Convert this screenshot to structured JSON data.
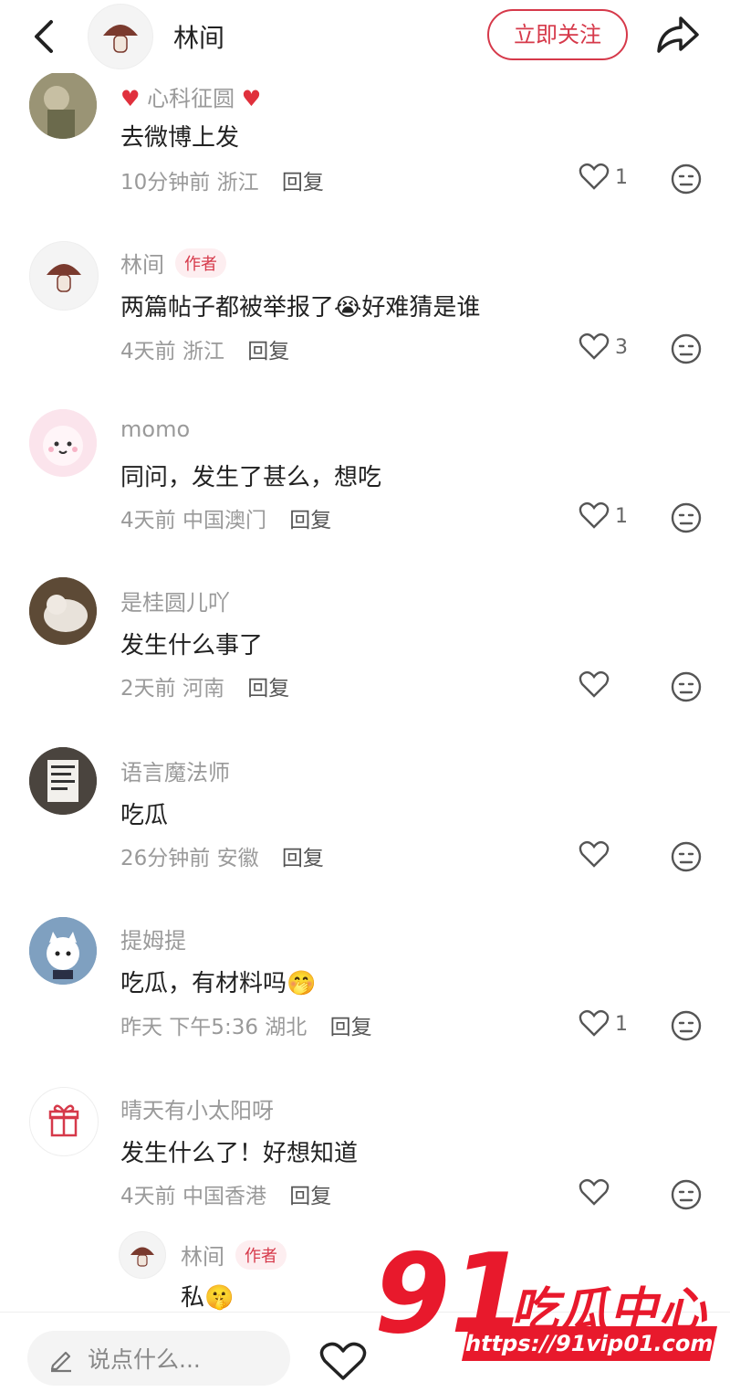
{
  "header": {
    "title": "林间",
    "follow_label": "立即关注"
  },
  "comments": [
    {
      "name": "心科征圆",
      "text": "去微博上发",
      "time": "10分钟前",
      "location": "浙江",
      "reply": "回复",
      "likes": "1",
      "author": ""
    },
    {
      "name": "林间",
      "text": "两篇帖子都被举报了😭好难猜是谁",
      "time": "4天前",
      "location": "浙江",
      "reply": "回复",
      "likes": "3",
      "author": "作者"
    },
    {
      "name": "momo",
      "text": "同问，发生了甚么，想吃",
      "time": "4天前",
      "location": "中国澳门",
      "reply": "回复",
      "likes": "1",
      "author": ""
    },
    {
      "name": "是桂圆儿吖",
      "text": "发生什么事了",
      "time": "2天前",
      "location": "河南",
      "reply": "回复",
      "likes": "",
      "author": ""
    },
    {
      "name": "语言魔法师",
      "text": "吃瓜",
      "time": "26分钟前",
      "location": "安徽",
      "reply": "回复",
      "likes": "",
      "author": ""
    },
    {
      "name": "提姆提",
      "text": "吃瓜，有材料吗🤭",
      "time": "昨天 下午5:36",
      "location": "湖北",
      "reply": "回复",
      "likes": "1",
      "author": ""
    },
    {
      "name": "晴天有小太阳呀",
      "text": "发生什么了！好想知道",
      "time": "4天前",
      "location": "中国香港",
      "reply": "回复",
      "likes": "",
      "author": ""
    }
  ],
  "sub_reply": {
    "name": "林间",
    "author": "作者",
    "text": "私🤫"
  },
  "bottom": {
    "placeholder": "说点什么..."
  },
  "watermark": {
    "number": "91",
    "brand": "吃瓜中心",
    "url": "https://91vip01.com"
  },
  "colors": {
    "accent": "#d6394a",
    "watermark_red": "#e8192c",
    "muted": "#9a9a9a"
  }
}
